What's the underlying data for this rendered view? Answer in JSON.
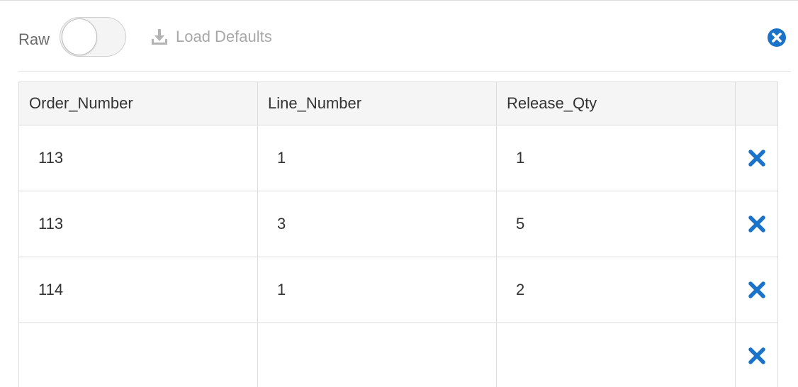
{
  "toolbar": {
    "raw_label": "Raw",
    "raw_toggle_on": false,
    "load_defaults_label": "Load Defaults"
  },
  "table": {
    "columns": [
      "Order_Number",
      "Line_Number",
      "Release_Qty",
      ""
    ],
    "rows": [
      [
        "113",
        "1",
        "1"
      ],
      [
        "113",
        "3",
        "5"
      ],
      [
        "114",
        "1",
        "2"
      ],
      [
        "",
        "",
        ""
      ]
    ]
  },
  "icons": {
    "load_defaults": "download-icon",
    "close": "close-circle-icon",
    "row_delete": "delete-x-icon"
  },
  "colors": {
    "accent": "#1a73c9",
    "muted_text": "#a8a8a8",
    "header_bg": "#f5f5f5",
    "border": "#dddddd"
  }
}
